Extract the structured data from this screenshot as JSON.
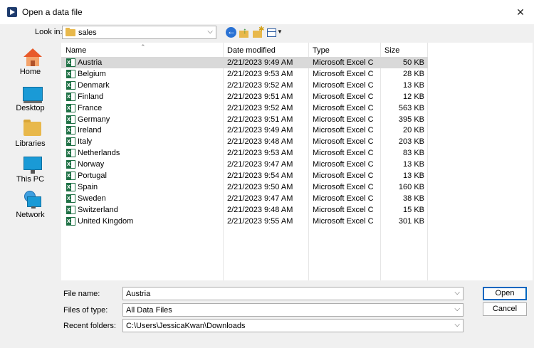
{
  "window": {
    "title": "Open a data file",
    "close_symbol": "✕"
  },
  "lookin": {
    "label": "Look in:",
    "value": "sales"
  },
  "places": [
    {
      "label": "Home",
      "icon": "home-icon"
    },
    {
      "label": "Desktop",
      "icon": "desktop-icon"
    },
    {
      "label": "Libraries",
      "icon": "libraries-icon"
    },
    {
      "label": "This PC",
      "icon": "this-pc-icon"
    },
    {
      "label": "Network",
      "icon": "network-icon"
    }
  ],
  "columns": {
    "name": "Name",
    "date": "Date modified",
    "type": "Type",
    "size": "Size"
  },
  "files": [
    {
      "name": "Austria",
      "date": "2/21/2023 9:49 AM",
      "type": "Microsoft Excel C...",
      "size": "50 KB",
      "selected": true
    },
    {
      "name": "Belgium",
      "date": "2/21/2023 9:53 AM",
      "type": "Microsoft Excel C...",
      "size": "28 KB"
    },
    {
      "name": "Denmark",
      "date": "2/21/2023 9:52 AM",
      "type": "Microsoft Excel C...",
      "size": "13 KB"
    },
    {
      "name": "Finland",
      "date": "2/21/2023 9:51 AM",
      "type": "Microsoft Excel C...",
      "size": "12 KB"
    },
    {
      "name": "France",
      "date": "2/21/2023 9:52 AM",
      "type": "Microsoft Excel C...",
      "size": "563 KB"
    },
    {
      "name": "Germany",
      "date": "2/21/2023 9:51 AM",
      "type": "Microsoft Excel C...",
      "size": "395 KB"
    },
    {
      "name": "Ireland",
      "date": "2/21/2023 9:49 AM",
      "type": "Microsoft Excel C...",
      "size": "20 KB"
    },
    {
      "name": "Italy",
      "date": "2/21/2023 9:48 AM",
      "type": "Microsoft Excel C...",
      "size": "203 KB"
    },
    {
      "name": "Netherlands",
      "date": "2/21/2023 9:53 AM",
      "type": "Microsoft Excel C...",
      "size": "83 KB"
    },
    {
      "name": "Norway",
      "date": "2/21/2023 9:47 AM",
      "type": "Microsoft Excel C...",
      "size": "13 KB"
    },
    {
      "name": "Portugal",
      "date": "2/21/2023 9:54 AM",
      "type": "Microsoft Excel C...",
      "size": "13 KB"
    },
    {
      "name": "Spain",
      "date": "2/21/2023 9:50 AM",
      "type": "Microsoft Excel C...",
      "size": "160 KB"
    },
    {
      "name": "Sweden",
      "date": "2/21/2023 9:47 AM",
      "type": "Microsoft Excel C...",
      "size": "38 KB"
    },
    {
      "name": "Switzerland",
      "date": "2/21/2023 9:48 AM",
      "type": "Microsoft Excel C...",
      "size": "15 KB"
    },
    {
      "name": "United Kingdom",
      "date": "2/21/2023 9:55 AM",
      "type": "Microsoft Excel C...",
      "size": "301 KB"
    }
  ],
  "form": {
    "filename_label": "File name:",
    "filename_value": "Austria",
    "filetype_label": "Files of type:",
    "filetype_value": "All Data Files",
    "recent_label": "Recent folders:",
    "recent_value": "C:\\Users\\JessicaKwan\\Downloads"
  },
  "buttons": {
    "open": "Open",
    "cancel": "Cancel"
  }
}
